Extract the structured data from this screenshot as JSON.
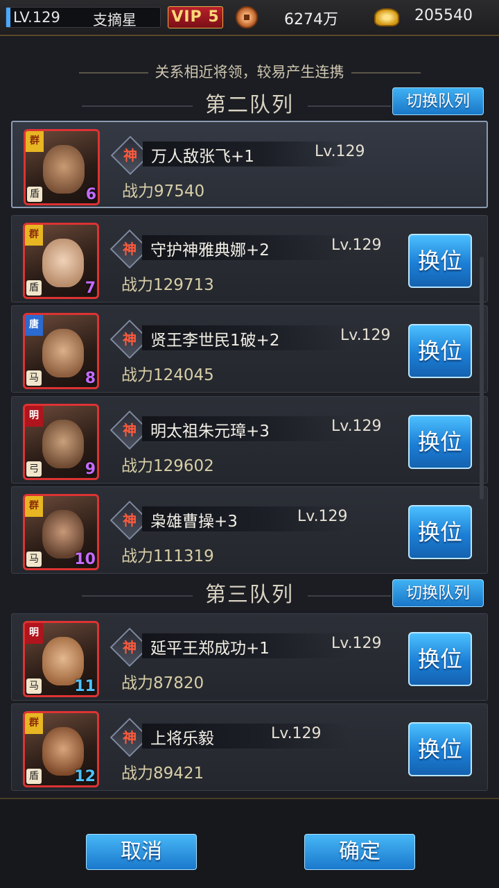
{
  "topbar": {
    "level": "LV.129",
    "player_name": "支摘星",
    "vip": "VIP 5",
    "coins": "6274万",
    "gold": "205540"
  },
  "hint": "关系相近将领，较易产生连携",
  "sections": [
    {
      "title": "第二队列",
      "switch_label": "切换队列"
    },
    {
      "title": "第三队列",
      "switch_label": "切换队列"
    }
  ],
  "swap_label": "换位",
  "god_char": "神",
  "heroes": [
    {
      "name": "万人敌张飞+1",
      "level": "Lv.129",
      "power": "战力97540",
      "faction": "群",
      "role": "盾",
      "pos": "6"
    },
    {
      "name": "守护神雅典娜+2",
      "level": "Lv.129",
      "power": "战力129713",
      "faction": "群",
      "role": "盾",
      "pos": "7"
    },
    {
      "name": "贤王李世民1破+2",
      "level": "Lv.129",
      "power": "战力124045",
      "faction": "唐",
      "role": "马",
      "pos": "8"
    },
    {
      "name": "明太祖朱元璋+3",
      "level": "Lv.129",
      "power": "战力129602",
      "faction": "明",
      "role": "弓",
      "pos": "9"
    },
    {
      "name": "枭雄曹操+3",
      "level": "Lv.129",
      "power": "战力111319",
      "faction": "群",
      "role": "马",
      "pos": "10"
    },
    {
      "name": "延平王郑成功+1",
      "level": "Lv.129",
      "power": "战力87820",
      "faction": "明",
      "role": "马",
      "pos": "11"
    },
    {
      "name": "上将乐毅",
      "level": "Lv.129",
      "power": "战力89421",
      "faction": "群",
      "role": "盾",
      "pos": "12"
    }
  ],
  "buttons": {
    "cancel": "取消",
    "confirm": "确定"
  }
}
